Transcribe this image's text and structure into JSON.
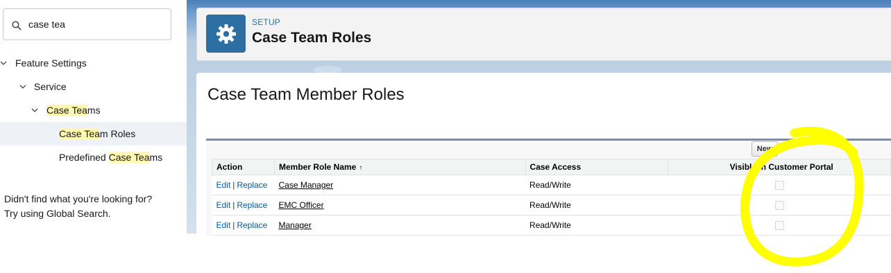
{
  "sidebar": {
    "search": {
      "value": "case tea",
      "icon": "search-icon"
    },
    "tree": {
      "feature_settings": "Feature Settings",
      "service": "Service",
      "case_teams": {
        "highlight": "Case Tea",
        "rest": "ms"
      },
      "case_team_roles": {
        "highlight": "Case Tea",
        "rest": "m Roles"
      },
      "predefined": {
        "prefix": "Predefined ",
        "highlight": "Case Tea",
        "rest": "ms"
      }
    },
    "help": {
      "line1": "Didn't find what you're looking for?",
      "line2": "Try using Global Search."
    }
  },
  "header": {
    "setup_label": "SETUP",
    "title": "Case Team Roles",
    "icon": "gear-icon"
  },
  "content": {
    "title": "Case Team Member Roles",
    "new_button": "New",
    "columns": [
      "Action",
      "Member Role Name",
      "Case Access",
      "Visible in Customer Portal"
    ],
    "sort_indicator": "↑",
    "rows": [
      {
        "edit": "Edit",
        "sep": "|",
        "replace": "Replace",
        "name": "Case Manager",
        "access": "Read/Write",
        "visible": false
      },
      {
        "edit": "Edit",
        "sep": "|",
        "replace": "Replace",
        "name": "EMC Officer",
        "access": "Read/Write",
        "visible": false
      },
      {
        "edit": "Edit",
        "sep": "|",
        "replace": "Replace",
        "name": "Manager",
        "access": "Read/Write",
        "visible": false
      }
    ]
  },
  "colors": {
    "link": "#015ba7",
    "setup_icon_bg": "#2e6fa3",
    "highlight": "#fff9b0",
    "annotation": "#ffff00"
  }
}
